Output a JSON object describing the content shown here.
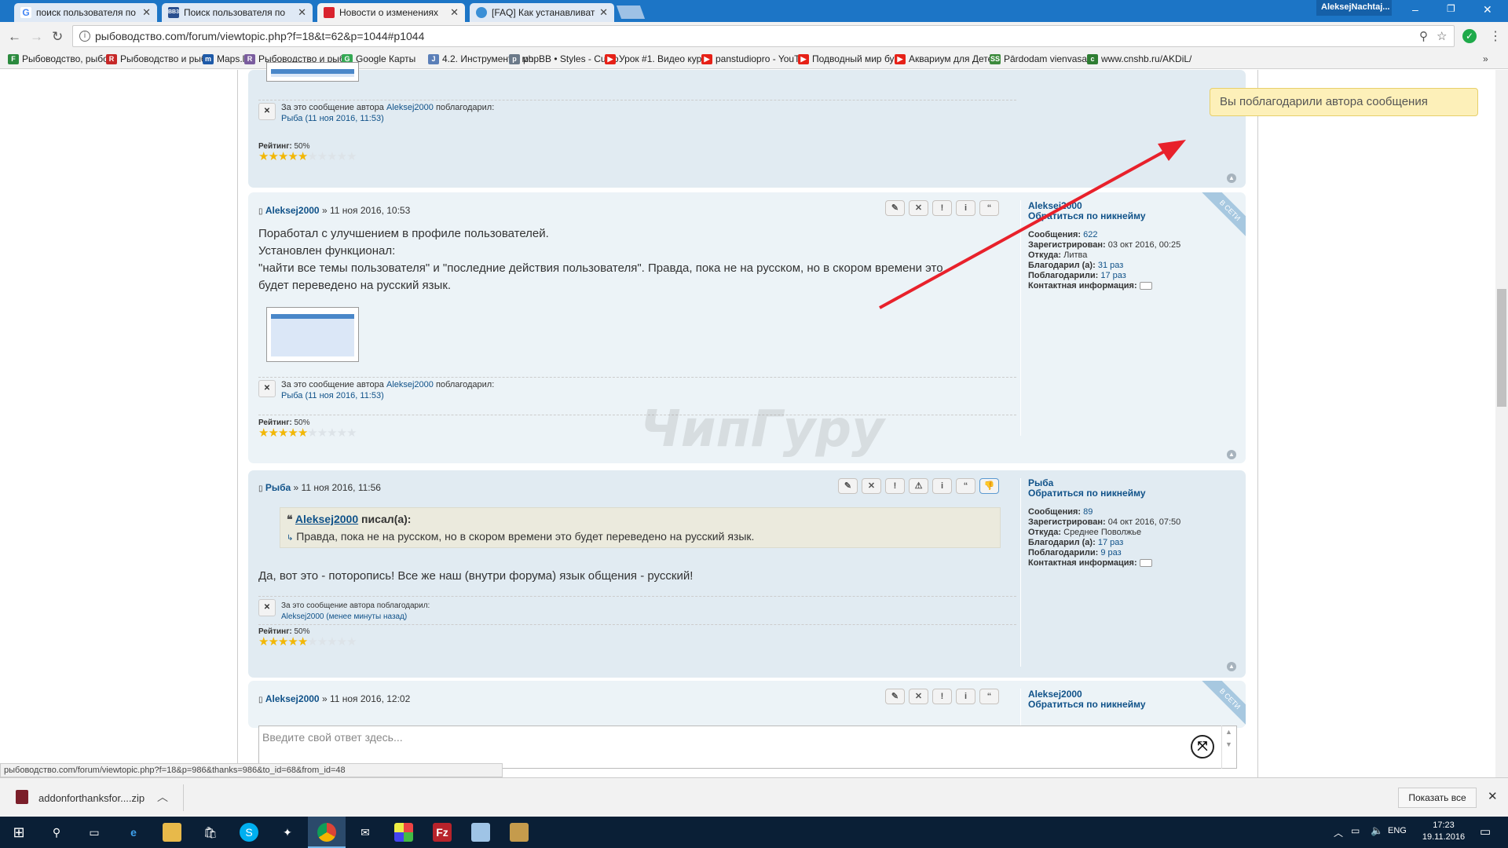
{
  "browser": {
    "tabs": [
      {
        "title": "поиск пользователя по",
        "color": "#ffffff"
      },
      {
        "title": "Поиск пользователя по",
        "color": "#2a4f8f"
      },
      {
        "title": "Новости о изменениях",
        "color": "#d9232d"
      },
      {
        "title": "[FAQ] Как устанавливат",
        "color": "#3a8fd6"
      }
    ],
    "profile_name": "AleksejNachtaj...",
    "url": "рыбоводство.com/forum/viewtopic.php?f=18&t=62&p=1044#p1044",
    "bookmarks": [
      {
        "label": "Рыбоводство, рыбор",
        "icon": "F",
        "color": "#2b8a3e"
      },
      {
        "label": "Рыбоводство и рыбо",
        "icon": "R",
        "color": "#c62828"
      },
      {
        "label": "Maps.lt",
        "icon": "m",
        "color": "#1e5aa8"
      },
      {
        "label": "Рыбоводство и рыбо",
        "icon": "R",
        "color": "#7a5c9e"
      },
      {
        "label": "Google Карты",
        "icon": "G",
        "color": "#34a853"
      },
      {
        "label": "4.2. Инструменты мо",
        "icon": "J",
        "color": "#5b7fb8"
      },
      {
        "label": "phpBB • Styles - Custo",
        "icon": "p",
        "color": "#6c7a89"
      },
      {
        "label": "Урок #1. Видео курс",
        "icon": "▶",
        "color": "#e62117"
      },
      {
        "label": "panstudiopro - YouTu",
        "icon": "▶",
        "color": "#e62117"
      },
      {
        "label": "Подводный мир бух",
        "icon": "▶",
        "color": "#e62117"
      },
      {
        "label": "Аквариум для Детей",
        "icon": "▶",
        "color": "#e62117"
      },
      {
        "label": "Pārdodam vienvasarā",
        "icon": "SS",
        "color": "#3d8b3d"
      },
      {
        "label": "www.cnshb.ru/AKDiL/",
        "icon": "c",
        "color": "#2e7d32"
      }
    ]
  },
  "notification": "Вы поблагодарили автора сообщения",
  "posts": [
    {
      "thanks_prefix": "За это сообщение автора",
      "thanks_author": "Aleksej2000",
      "thanks_suffix": "поблагодарил:",
      "thanks_by": "Рыба (11 ноя 2016, 11:53)",
      "rating_label": "Рейтинг:",
      "rating_value": "50%",
      "rating_fraction": 0.5
    },
    {
      "author": "Aleksej2000",
      "date": "» 11 ноя 2016, 10:53",
      "lines": [
        "Поработал с улучшением в профиле пользователей.",
        "Установлен функционал:",
        "\"найти все темы пользователя\" и \"последние действия пользователя\". Правда, пока не на русском, но в скором времени это",
        "будет переведено на русский язык."
      ],
      "thanks_prefix": "За это сообщение автора",
      "thanks_author": "Aleksej2000",
      "thanks_suffix": "поблагодарил:",
      "thanks_by": "Рыба (11 ноя 2016, 11:53)",
      "rating_label": "Рейтинг:",
      "rating_value": "50%",
      "rating_fraction": 0.5,
      "online_badge": "В СЕТИ",
      "profile": {
        "name": "Aleksej2000",
        "nickname_link": "Обратиться по никнейму",
        "posts_label": "Сообщения:",
        "posts": "622",
        "registered_label": "Зарегистрирован:",
        "registered": "03 окт 2016, 00:25",
        "from_label": "Откуда:",
        "from": "Литва",
        "thanked_label": "Благодарил (а):",
        "thanked": "31 раз",
        "was_thanked_label": "Поблагодарили:",
        "was_thanked": "17 раз",
        "contact_label": "Контактная информация:"
      }
    },
    {
      "author": "Рыба",
      "date": "» 11 ноя 2016, 11:56",
      "quote_author": "Aleksej2000",
      "quote_wrote": "писал(а):",
      "quote_text": "Правда, пока не на русском, но в скором времени это будет переведено на русский язык.",
      "text": "Да, вот это - поторопись! Все же наш (внутри форума) язык общения - русский!",
      "thanks_prefix": "За это сообщение автора поблагодарил:",
      "thanks_by": "Aleksej2000 (менее минуты назад)",
      "rating_label": "Рейтинг:",
      "rating_value": "50%",
      "rating_fraction": 0.5,
      "profile": {
        "name": "Рыба",
        "nickname_link": "Обратиться по никнейму",
        "posts_label": "Сообщения:",
        "posts": "89",
        "registered_label": "Зарегистрирован:",
        "registered": "04 окт 2016, 07:50",
        "from_label": "Откуда:",
        "from": "Среднее Поволжье",
        "thanked_label": "Благодарил (а):",
        "thanked": "17 раз",
        "was_thanked_label": "Поблагодарили:",
        "was_thanked": "9 раз",
        "contact_label": "Контактная информация:"
      }
    },
    {
      "author": "Aleksej2000",
      "date": "» 11 ноя 2016, 12:02",
      "online_badge": "В СЕТИ",
      "profile": {
        "name": "Aleksej2000",
        "nickname_link": "Обратиться по никнейму"
      }
    }
  ],
  "watermark": "ЧипГуру",
  "reply_placeholder": "Введите свой ответ здесь...",
  "status_url": "рыбоводство.com/forum/viewtopic.php?f=18&p=986&thanks=986&to_id=68&from_id=48",
  "download": {
    "file": "addonforthanksfor....zip",
    "show_all": "Показать все"
  },
  "taskbar": {
    "lang": "ENG",
    "time": "17:23",
    "date": "19.11.2016"
  },
  "colors": {
    "accent": "#105289",
    "post_bg": "#e1ebf2",
    "arrow": "#e8212b",
    "star": "#f2b705"
  }
}
